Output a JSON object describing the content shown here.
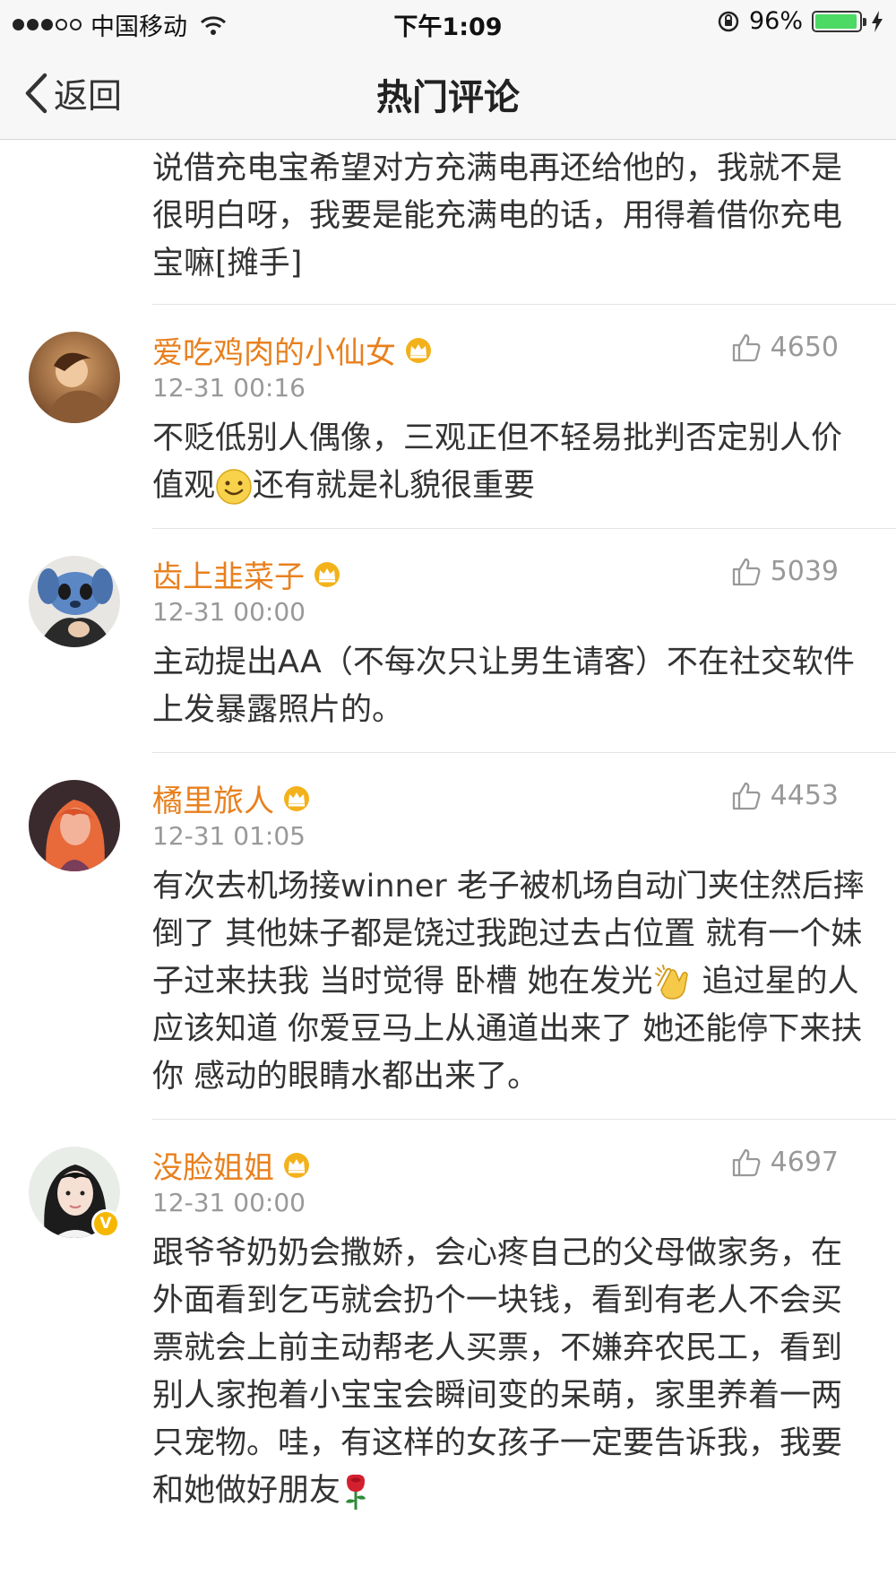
{
  "status_bar": {
    "carrier": "中国移动",
    "time": "下午1:09",
    "battery_text": "96%",
    "battery_level": 0.96,
    "signal_bars_filled": 3,
    "signal_bars_total": 5
  },
  "nav": {
    "back_label": "返回",
    "title": "热门评论"
  },
  "top_comment_tail": "说借充电宝希望对方充满电再还给他的，我就不是很明白呀，我要是能充满电的话，用得着借你充电宝嘛[摊手]",
  "comments": [
    {
      "user": "爱吃鸡肉的小仙女",
      "time": "12-31 00:16",
      "likes": "4650",
      "text_a": "不贬低别人偶像，三观正但不轻易批判否定别人价值观",
      "emoji": "smile-emoji",
      "text_b": "还有就是礼貌很重要"
    },
    {
      "user": "齿上韭菜子",
      "time": "12-31 00:00",
      "likes": "5039",
      "text": "主动提出AA（不每次只让男生请客）不在社交软件上发暴露照片的。"
    },
    {
      "user": "橘里旅人",
      "time": "12-31 01:05",
      "likes": "4453",
      "text_a": "有次去机场接winner  老子被机场自动门夹住然后摔倒了 其他妹子都是饶过我跑过去占位置  就有一个妹子过来扶我 当时觉得 卧槽  她在发光",
      "emoji": "clap-emoji",
      "text_b": " 追过星的人应该知道 你爱豆马上从通道出来了 她还能停下来扶你  感动的眼睛水都出来了。"
    },
    {
      "user": "没脸姐姐",
      "time": "12-31 00:00",
      "likes": "4697",
      "verified": true,
      "text_a": "跟爷爷奶奶会撒娇，会心疼自己的父母做家务，在外面看到乞丐就会扔个一块钱，看到有老人不会买票就会上前主动帮老人买票，不嫌弃农民工，看到别人家抱着小宝宝会瞬间变的呆萌，家里养着一两只宠物。哇，有这样的女孩子一定要告诉我，我要和她做好朋友",
      "emoji": "rose-emoji"
    }
  ],
  "colors": {
    "username": "#e8801e",
    "meta": "#999999",
    "text": "#333333",
    "bar_bg": "#f7f7f7"
  },
  "icons": {
    "back": "chevron-left-icon",
    "like": "thumbs-up-icon",
    "crown": "crown-badge-icon",
    "verified": "verified-v-icon"
  }
}
